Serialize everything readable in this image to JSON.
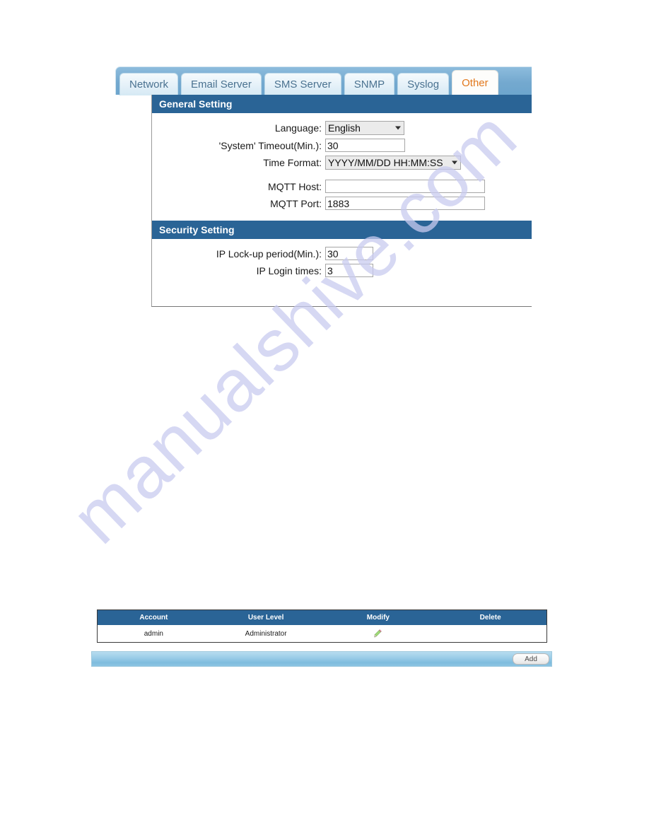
{
  "watermark": {
    "text": "manualshive.com"
  },
  "tabs": [
    {
      "label": "Network",
      "active": false
    },
    {
      "label": "Email Server",
      "active": false
    },
    {
      "label": "SMS Server",
      "active": false
    },
    {
      "label": "SNMP",
      "active": false
    },
    {
      "label": "Syslog",
      "active": false
    },
    {
      "label": "Other",
      "active": true
    }
  ],
  "general_setting": {
    "title": "General Setting",
    "fields": {
      "language": {
        "label": "Language:",
        "value": "English",
        "options": [
          "English"
        ]
      },
      "system_timeout": {
        "label": "'System' Timeout(Min.):",
        "value": "30"
      },
      "time_format": {
        "label": "Time Format:",
        "value": "YYYY/MM/DD HH:MM:SS",
        "options": [
          "YYYY/MM/DD HH:MM:SS"
        ]
      },
      "mqtt_host": {
        "label": "MQTT Host:",
        "value": ""
      },
      "mqtt_port": {
        "label": "MQTT Port:",
        "value": "1883"
      }
    }
  },
  "security_setting": {
    "title": "Security Setting",
    "fields": {
      "ip_lockup_period": {
        "label": "IP Lock-up period(Min.):",
        "value": "30"
      },
      "ip_login_times": {
        "label": "IP Login times:",
        "value": "3"
      }
    }
  },
  "account_table": {
    "columns": [
      "Account",
      "User Level",
      "Modify",
      "Delete"
    ],
    "rows": [
      {
        "account": "admin",
        "user_level": "Administrator",
        "modify": "edit-pencil-icon",
        "delete": ""
      }
    ]
  },
  "action_bar": {
    "add_label": "Add"
  },
  "colors": {
    "section_header_bg": "#2a6496",
    "tab_active_text": "#e2781c",
    "tab_text": "#4a7290",
    "tabstrip_bg": "#74a9cf",
    "watermark": "#c9cbf0"
  }
}
